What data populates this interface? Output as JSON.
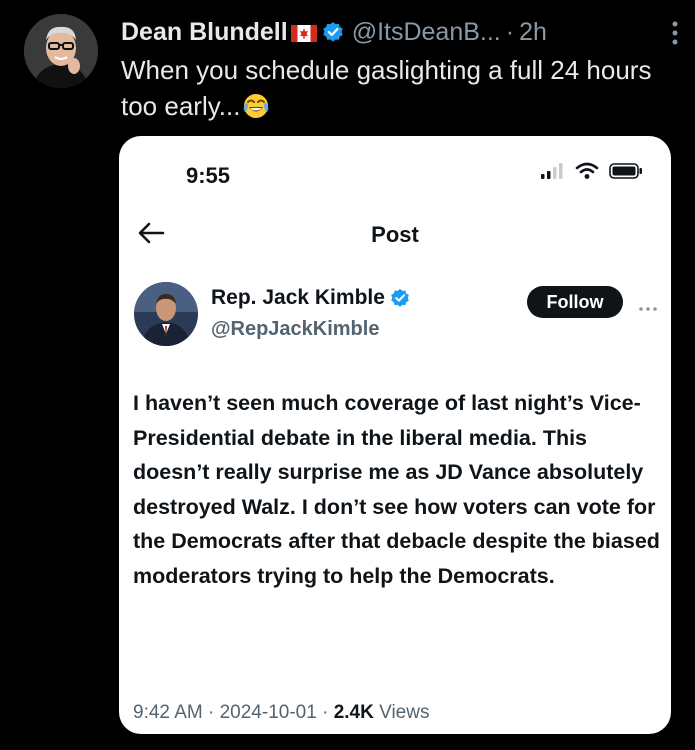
{
  "outer_tweet": {
    "author_name": "Dean Blundell",
    "handle": "@ItsDeanB...",
    "separator": "·",
    "time": "2h",
    "text": "When you schedule gaslighting a full 24 hours too early...",
    "avatar_icon": "person-avatar",
    "flag_icon": "canada-flag-icon",
    "verified_icon": "verified-badge-icon",
    "emoji_icon": "tears-of-joy-emoji-icon",
    "more_icon": "more-vertical-icon"
  },
  "embedded_screenshot": {
    "status_bar": {
      "time": "9:55",
      "icons": [
        "signal-icon",
        "wifi-icon",
        "battery-icon"
      ]
    },
    "nav": {
      "title": "Post",
      "back_icon": "back-arrow-icon"
    },
    "post": {
      "author_name": "Rep. Jack Kimble",
      "handle": "@RepJackKimble",
      "follow_label": "Follow",
      "verified_icon": "verified-badge-icon",
      "more_icon": "more-horizontal-icon",
      "text": "I haven’t seen much coverage of last night’s Vice-Presidential debate in the liberal media. This doesn’t really surprise me as JD Vance absolutely destroyed Walz. I don’t see how voters can vote for the Democrats after that debacle despite the biased moderators trying to help the Democrats.",
      "time": "9:42 AM",
      "sep1": " · ",
      "date": "2024-10-01",
      "sep2": " · ",
      "views_count": "2.4K",
      "views_label": " Views"
    }
  },
  "colors": {
    "background": "#000000",
    "text_primary": "#e7e9ea",
    "text_secondary": "#8b98a5",
    "verified_blue": "#1d9bf0",
    "card_background": "#ffffff",
    "button_dark": "#0f1419"
  }
}
